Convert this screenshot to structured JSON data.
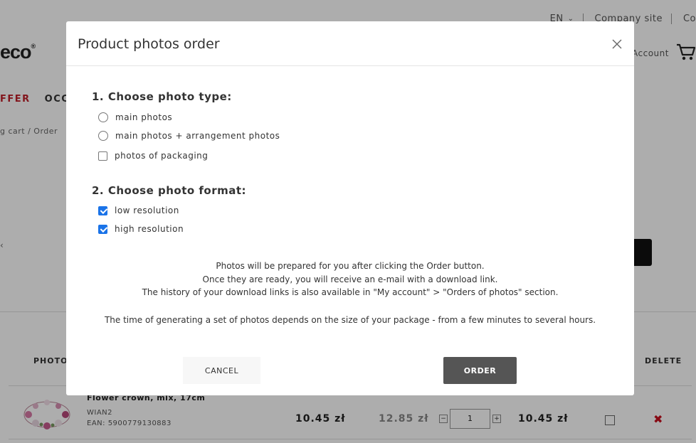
{
  "background": {
    "header": {
      "language": "EN",
      "company_site": "Company site",
      "partial_link": "Co",
      "logo_text": "eco",
      "logo_mark": "®",
      "account": "Account"
    },
    "nav": {
      "offer": "FFER",
      "occasions": "OCCA"
    },
    "breadcrumb": "g cart  /  Order",
    "side_mark": "‹",
    "table": {
      "photo_header": "PHOTO",
      "delete_header": "DELETE",
      "row": {
        "name": "Flower crown, mix, 17cm",
        "code": "WIAN2",
        "ean": "EAN: 5900779130883",
        "price": "10.45 zł",
        "old_price": "12.85 zł",
        "quantity": "1",
        "qty_minus": "−",
        "qty_plus": "+",
        "total": "10.45 zł",
        "delete": "✖"
      }
    }
  },
  "modal": {
    "title": "Product photos order",
    "section1_title": "1. Choose photo type:",
    "photo_types": [
      {
        "label": "main photos",
        "kind": "radio",
        "checked": false
      },
      {
        "label": "main photos + arrangement photos",
        "kind": "radio",
        "checked": false
      },
      {
        "label": "photos of packaging",
        "kind": "checkbox",
        "checked": false
      }
    ],
    "section2_title": "2. Choose photo format:",
    "formats": [
      {
        "label": "low resolution",
        "kind": "checkbox",
        "checked": true
      },
      {
        "label": "high resolution",
        "kind": "checkbox",
        "checked": true
      }
    ],
    "info_lines": [
      "Photos will be prepared for you after clicking the Order button.",
      "Once they are ready, you will receive an e-mail with a download link.",
      "The history of your download links is also available in \"My account\" > \"Orders of photos\" section."
    ],
    "time_note": "The time of generating a set of photos depends on the size of your package - from a few minutes to several hours.",
    "cancel_label": "CANCEL",
    "order_label": "ORDER"
  },
  "colors": {
    "accent_red": "#c0202a",
    "checkbox_blue": "#1a73e8",
    "order_button": "#555555"
  }
}
